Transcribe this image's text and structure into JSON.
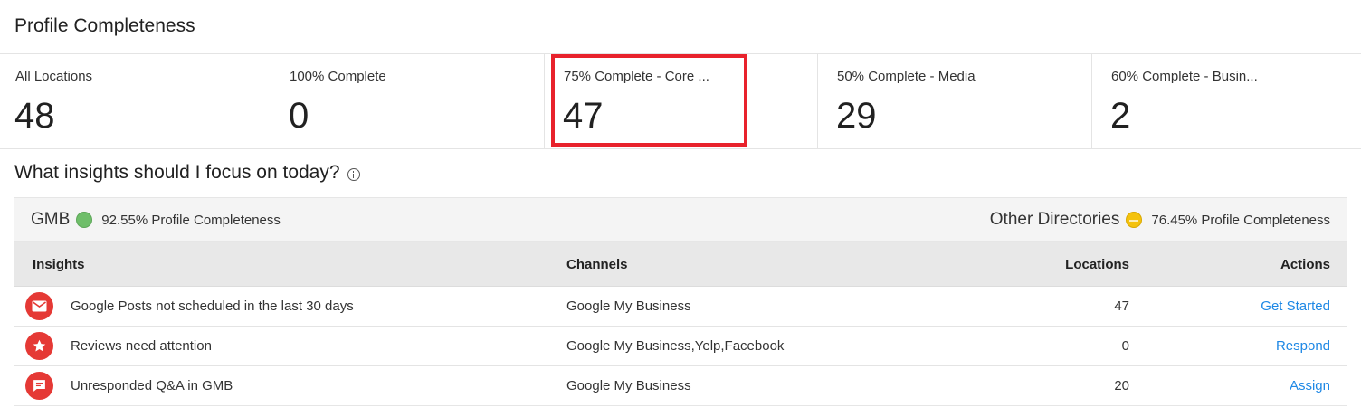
{
  "page_title": "Profile Completeness",
  "stats": [
    {
      "label": "All Locations",
      "value": "48"
    },
    {
      "label": "100% Complete",
      "value": "0"
    },
    {
      "label": "75% Complete - Core ...",
      "value": "47"
    },
    {
      "label": "50% Complete - Media",
      "value": "29"
    },
    {
      "label": "60% Complete - Busin...",
      "value": "2"
    }
  ],
  "insights_title": "What insights should I focus on today?",
  "summary": {
    "left": {
      "name": "GMB",
      "status_color": "#6fbe6a",
      "text": "92.55% Profile Completeness"
    },
    "right": {
      "name": "Other Directories",
      "status_color": "#f4c20d",
      "text": "76.45% Profile Completeness"
    }
  },
  "table": {
    "headers": {
      "insights": "Insights",
      "channels": "Channels",
      "locations": "Locations",
      "actions": "Actions"
    },
    "rows": [
      {
        "icon": "mail-icon",
        "insight": "Google Posts not scheduled in the last 30 days",
        "channels": "Google My Business",
        "locations": "47",
        "action": "Get Started"
      },
      {
        "icon": "star-icon",
        "insight": "Reviews need attention",
        "channels": "Google My Business,Yelp,Facebook",
        "locations": "0",
        "action": "Respond"
      },
      {
        "icon": "chat-icon",
        "insight": "Unresponded Q&A in GMB",
        "channels": "Google My Business",
        "locations": "20",
        "action": "Assign"
      }
    ]
  },
  "colors": {
    "accent": "#1e88e5",
    "highlight": "#e8222c",
    "icon_bg": "#e53935"
  }
}
